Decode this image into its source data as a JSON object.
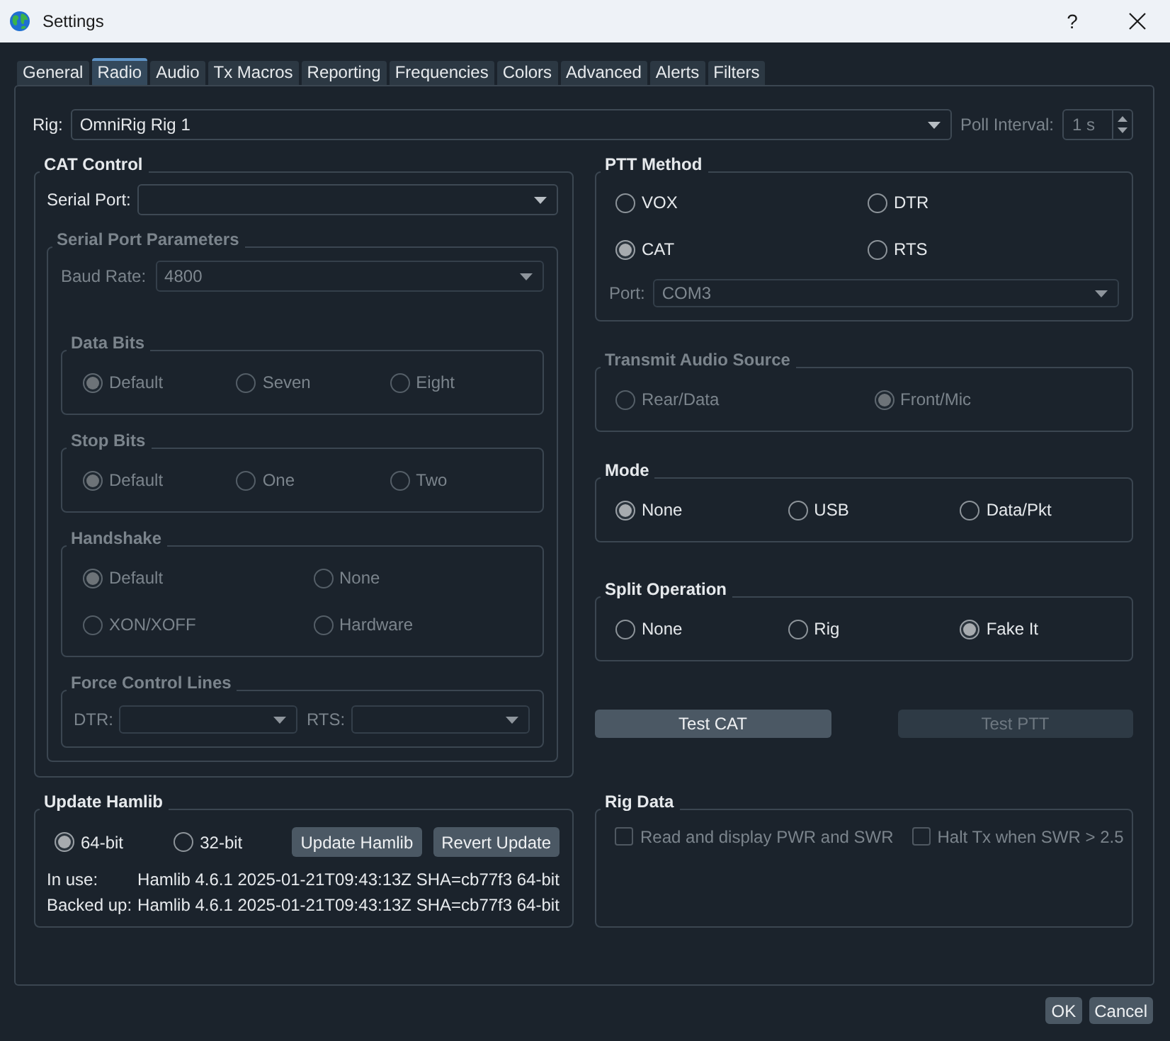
{
  "window": {
    "title": "Settings",
    "help": "?"
  },
  "tabs": [
    {
      "label": "General",
      "selected": false
    },
    {
      "label": "Radio",
      "selected": true
    },
    {
      "label": "Audio",
      "selected": false
    },
    {
      "label": "Tx Macros",
      "selected": false
    },
    {
      "label": "Reporting",
      "selected": false
    },
    {
      "label": "Frequencies",
      "selected": false
    },
    {
      "label": "Colors",
      "selected": false
    },
    {
      "label": "Advanced",
      "selected": false
    },
    {
      "label": "Alerts",
      "selected": false
    },
    {
      "label": "Filters",
      "selected": false
    }
  ],
  "rig": {
    "label": "Rig:",
    "value": "OmniRig Rig 1"
  },
  "poll_interval": {
    "label": "Poll Interval:",
    "value": "1 s",
    "disabled": true
  },
  "cat_control": {
    "title": "CAT Control",
    "serial_port": {
      "label": "Serial Port:"
    },
    "serial_parameters": {
      "title": "Serial Port Parameters",
      "disabled": true,
      "baud_rate": {
        "label": "Baud Rate:",
        "value": "4800"
      },
      "groups": [
        {
          "title": "Data Bits",
          "options": [
            {
              "label": "Default",
              "selected": true
            },
            {
              "label": "Seven",
              "selected": false
            },
            {
              "label": "Eight",
              "selected": false
            }
          ]
        },
        {
          "title": "Stop Bits",
          "options": [
            {
              "label": "Default",
              "selected": true
            },
            {
              "label": "One",
              "selected": false
            },
            {
              "label": "Two",
              "selected": false
            }
          ]
        },
        {
          "title": "Handshake",
          "options": [
            {
              "label": "Default",
              "selected": true
            },
            {
              "label": "None",
              "selected": false
            },
            {
              "label": "XON/XOFF",
              "selected": false
            },
            {
              "label": "Hardware",
              "selected": false
            }
          ]
        }
      ],
      "force_control_lines": {
        "title": "Force Control Lines",
        "fields": [
          {
            "label": "DTR:"
          },
          {
            "label": "RTS:"
          }
        ]
      }
    }
  },
  "ptt_method": {
    "title": "PTT Method",
    "options": [
      {
        "label": "VOX",
        "selected": false
      },
      {
        "label": "DTR",
        "selected": false
      },
      {
        "label": "CAT",
        "selected": true
      },
      {
        "label": "RTS",
        "selected": false
      }
    ],
    "port": {
      "label": "Port:",
      "value": "COM3",
      "disabled": true
    }
  },
  "transmit_audio_source": {
    "title": "Transmit Audio Source",
    "disabled": true,
    "options": [
      {
        "label": "Rear/Data",
        "selected": false
      },
      {
        "label": "Front/Mic",
        "selected": true
      }
    ]
  },
  "mode": {
    "title": "Mode",
    "options": [
      {
        "label": "None",
        "selected": true
      },
      {
        "label": "USB",
        "selected": false
      },
      {
        "label": "Data/Pkt",
        "selected": false
      }
    ]
  },
  "split_operation": {
    "title": "Split Operation",
    "options": [
      {
        "label": "None",
        "selected": false
      },
      {
        "label": "Rig",
        "selected": false
      },
      {
        "label": "Fake It",
        "selected": true
      }
    ]
  },
  "test_buttons": [
    {
      "label": "Test CAT",
      "disabled": false
    },
    {
      "label": "Test PTT",
      "disabled": true
    }
  ],
  "update_hamlib": {
    "title": "Update Hamlib",
    "options": [
      {
        "label": "64-bit",
        "selected": true
      },
      {
        "label": "32-bit",
        "selected": false
      }
    ],
    "buttons": [
      "Update Hamlib",
      "Revert Update"
    ],
    "info": [
      {
        "label": "In use:",
        "value": "Hamlib 4.6.1 2025-01-21T09:43:13Z SHA=cb77f3 64-bit"
      },
      {
        "label": "Backed up:",
        "value": "Hamlib 4.6.1 2025-01-21T09:43:13Z SHA=cb77f3 64-bit"
      }
    ]
  },
  "rig_data": {
    "title": "Rig Data",
    "checks": [
      {
        "label": "Read and display PWR and SWR",
        "checked": false,
        "disabled": true
      },
      {
        "label": "Halt Tx when SWR > 2.5",
        "checked": false,
        "disabled": true
      }
    ]
  },
  "dialog_buttons": [
    "OK",
    "Cancel"
  ]
}
